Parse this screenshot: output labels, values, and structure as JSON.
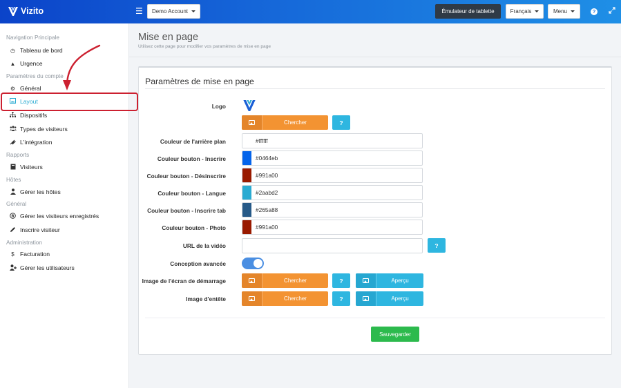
{
  "app": {
    "brand": "Vizito"
  },
  "topbar": {
    "account_label": "Demo Account",
    "tablet_label": "Émulateur de tablette",
    "language_label": "Français",
    "menu_label": "Menu",
    "help_label": "?"
  },
  "sidebar": {
    "sec_nav": "Navigation Principale",
    "dashboard": "Tableau de bord",
    "urgence": "Urgence",
    "sec_params": "Paramètres du compte",
    "general": "Général",
    "layout": "Layout",
    "devices": "Dispositifs",
    "visitor_types": "Types de visiteurs",
    "integration": "L'intégration",
    "sec_reports": "Rapports",
    "visitors": "Visiteurs",
    "sec_hosts": "Hôtes",
    "manage_hosts": "Gérer les hôtes",
    "sec_general": "Général",
    "registered_visitors": "Gérer les visiteurs enregistrés",
    "register_visitor": "Inscrire visiteur",
    "sec_admin": "Administration",
    "billing": "Facturation",
    "manage_users": "Gérer les utilisateurs"
  },
  "page": {
    "title": "Mise en page",
    "subtitle": "Utilisez cette page pour modifier vos paramètres de mise en page"
  },
  "card": {
    "title": "Paramètres de mise en page",
    "logo_label": "Logo",
    "search_label": "Chercher",
    "question": "?",
    "preview_label": "Aperçu",
    "bg_label": "Couleur de l'arrière plan",
    "bg_value": "#ffffff",
    "btn_register_label": "Couleur bouton - Inscrire",
    "btn_register_value": "#0464eb",
    "btn_unregister_label": "Couleur bouton - Désinscrire",
    "btn_unregister_value": "#991a00",
    "btn_lang_label": "Couleur bouton - Langue",
    "btn_lang_value": "#2aabd2",
    "btn_register_tab_label": "Couleur bouton - Inscrire tab",
    "btn_register_tab_value": "#265a88",
    "btn_photo_label": "Couleur bouton - Photo",
    "btn_photo_value": "#991a00",
    "video_label": "URL de la vidéo",
    "video_value": "",
    "advanced_label": "Conception avancée",
    "splash_label": "Image de l'écran de démarrage",
    "header_img_label": "Image d'entête",
    "save_label": "Sauvegarder"
  },
  "colors": {
    "register": "#0464eb",
    "unregister": "#991a00",
    "lang": "#2aabd2",
    "register_tab": "#265a88",
    "photo": "#991a00",
    "bg": "#ffffff"
  }
}
